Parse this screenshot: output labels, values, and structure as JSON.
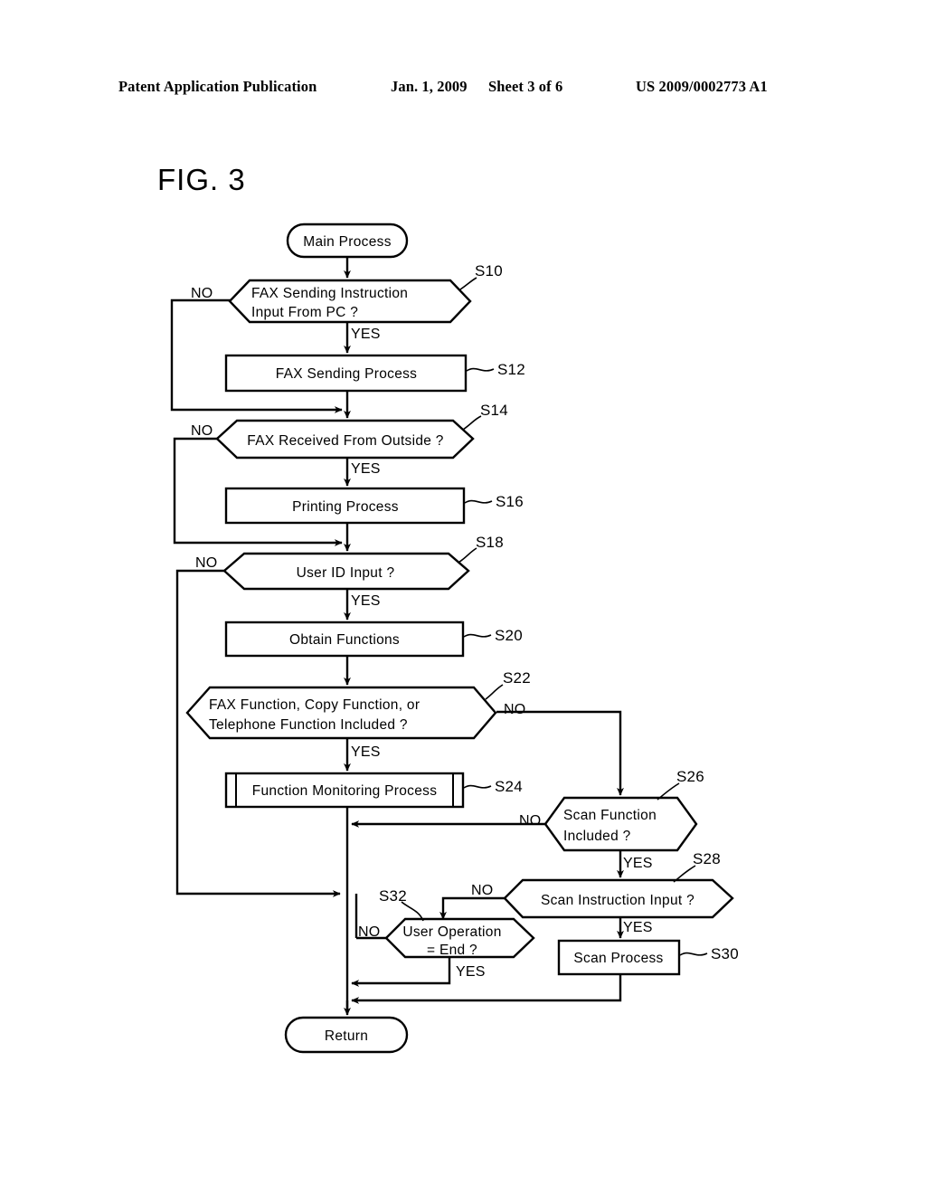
{
  "header": {
    "publication": "Patent Application Publication",
    "date": "Jan. 1, 2009",
    "sheet": "Sheet 3 of 6",
    "docnum": "US 2009/0002773 A1"
  },
  "figure": {
    "title": "FIG. 3"
  },
  "chart_data": {
    "type": "diagram",
    "diagram_type": "flowchart",
    "title": "FIG. 3",
    "nodes": [
      {
        "id": "start",
        "shape": "terminator",
        "label": "Main Process",
        "step": ""
      },
      {
        "id": "s10",
        "shape": "decision",
        "label": "FAX Sending Instruction Input From PC ?",
        "step": "S10"
      },
      {
        "id": "s12",
        "shape": "process",
        "label": "FAX Sending Process",
        "step": "S12"
      },
      {
        "id": "s14",
        "shape": "decision",
        "label": "FAX Received From Outside ?",
        "step": "S14"
      },
      {
        "id": "s16",
        "shape": "process",
        "label": "Printing Process",
        "step": "S16"
      },
      {
        "id": "s18",
        "shape": "decision",
        "label": "User ID Input ?",
        "step": "S18"
      },
      {
        "id": "s20",
        "shape": "process",
        "label": "Obtain Functions",
        "step": "S20"
      },
      {
        "id": "s22",
        "shape": "decision",
        "label": "FAX Function, Copy Function, or Telephone Function Included  ?",
        "step": "S22"
      },
      {
        "id": "s24",
        "shape": "predefined",
        "label": "Function Monitoring Process",
        "step": "S24"
      },
      {
        "id": "s26",
        "shape": "decision",
        "label": "Scan Function Included ?",
        "step": "S26"
      },
      {
        "id": "s28",
        "shape": "decision",
        "label": "Scan Instruction Input ?",
        "step": "S28"
      },
      {
        "id": "s30",
        "shape": "process",
        "label": "Scan Process",
        "step": "S30"
      },
      {
        "id": "s32",
        "shape": "decision",
        "label": "User Operation = End ?",
        "step": "S32"
      },
      {
        "id": "end",
        "shape": "terminator",
        "label": "Return",
        "step": ""
      }
    ],
    "node_labels": {
      "start": "Main Process",
      "s10_l1": "FAX Sending Instruction",
      "s10_l2": "Input From PC ?",
      "s12": "FAX Sending Process",
      "s14": "FAX Received From Outside ?",
      "s16": "Printing Process",
      "s18": "User ID Input ?",
      "s20": "Obtain Functions",
      "s22_l1": "FAX Function, Copy Function, or",
      "s22_l2": "Telephone Function Included  ?",
      "s24": "Function Monitoring Process",
      "s26_l1": "Scan Function",
      "s26_l2": "Included ?",
      "s28": "Scan Instruction Input ?",
      "s30": "Scan Process",
      "s32_l1": "User Operation",
      "s32_l2": "= End ?",
      "end": "Return"
    },
    "step_labels": {
      "s10": "S10",
      "s12": "S12",
      "s14": "S14",
      "s16": "S16",
      "s18": "S18",
      "s20": "S20",
      "s22": "S22",
      "s24": "S24",
      "s26": "S26",
      "s28": "S28",
      "s30": "S30",
      "s32": "S32"
    },
    "branch_labels": {
      "s10_no": "NO",
      "s10_yes": "YES",
      "s14_no": "NO",
      "s14_yes": "YES",
      "s18_no": "NO",
      "s18_yes": "YES",
      "s22_no": "NO",
      "s22_yes": "YES",
      "s26_no": "NO",
      "s26_yes": "YES",
      "s28_no": "NO",
      "s28_yes": "YES",
      "s32_no": "NO",
      "s32_yes": "YES"
    },
    "edges": [
      {
        "from": "start",
        "to": "s10",
        "label": ""
      },
      {
        "from": "s10",
        "to": "s12",
        "label": "YES"
      },
      {
        "from": "s10",
        "to": "s14",
        "label": "NO"
      },
      {
        "from": "s12",
        "to": "s14",
        "label": ""
      },
      {
        "from": "s14",
        "to": "s16",
        "label": "YES"
      },
      {
        "from": "s14",
        "to": "s18",
        "label": "NO"
      },
      {
        "from": "s16",
        "to": "s18",
        "label": ""
      },
      {
        "from": "s18",
        "to": "s20",
        "label": "YES"
      },
      {
        "from": "s18",
        "to": "end",
        "label": "NO"
      },
      {
        "from": "s20",
        "to": "s22",
        "label": ""
      },
      {
        "from": "s22",
        "to": "s24",
        "label": "YES"
      },
      {
        "from": "s22",
        "to": "s26",
        "label": "NO"
      },
      {
        "from": "s24",
        "to": "s32",
        "label": ""
      },
      {
        "from": "s26",
        "to": "s28",
        "label": "YES"
      },
      {
        "from": "s26",
        "to": "s32",
        "label": "NO"
      },
      {
        "from": "s28",
        "to": "s30",
        "label": "YES"
      },
      {
        "from": "s28",
        "to": "s32",
        "label": "NO"
      },
      {
        "from": "s30",
        "to": "end",
        "label": ""
      },
      {
        "from": "s32",
        "to": "end",
        "label": "YES"
      },
      {
        "from": "s32",
        "to": "s18",
        "label": "NO"
      }
    ],
    "colors": {
      "stroke": "#000000",
      "fill": "#ffffff",
      "background": "#ffffff"
    }
  }
}
